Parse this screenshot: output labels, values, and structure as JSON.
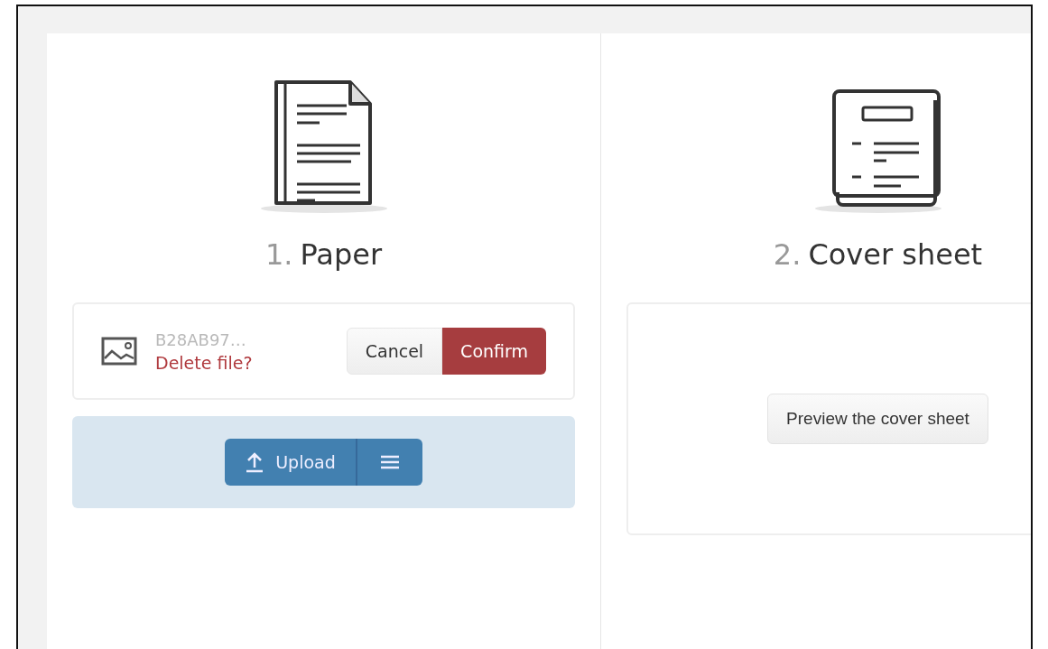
{
  "steps": [
    {
      "number": "1.",
      "title": "Paper",
      "kind": "upload",
      "file": {
        "name": "B28AB97…",
        "prompt": "Delete file?",
        "cancel": "Cancel",
        "confirm": "Confirm"
      },
      "upload_button": "Upload"
    },
    {
      "number": "2.",
      "title": "Cover sheet",
      "kind": "preview",
      "preview_button": "Preview the cover sheet"
    }
  ]
}
